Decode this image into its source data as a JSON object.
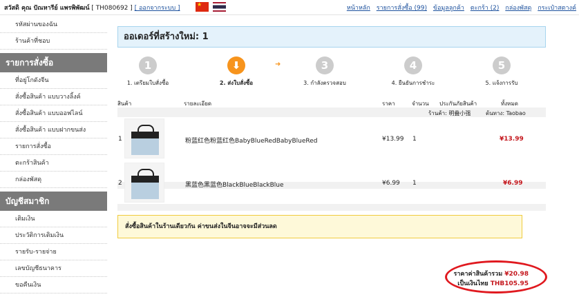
{
  "header": {
    "user_name": "สวัสดิ คุณ ปัณหารีย์ แพรพิพัฒน์",
    "user_code": "[ TH080692 ]",
    "logout": "[ ออกจากระบบ ]",
    "links": [
      "หน้าหลัก",
      "รายการสั่งซื้อ (99)",
      "ข้อมูลลูกค้า",
      "ตะกร้า (2)",
      "กล่องพัสดุ",
      "กระเป๋าสตางค์"
    ]
  },
  "sidebar": {
    "top_items": [
      "รหัสผ่านของฉัน",
      "ร้านค้าที่ชอบ"
    ],
    "section1_title": "รายการสั่งซื้อ",
    "section1_items": [
      "ที่อยู่โกดังจีน",
      "สั่งซื้อสินค้า แบบวางลิ้งค์",
      "สั่งซื้อสินค้า แบบออฟไลน์",
      "สั่งซื้อสินค้า แบบฝากขนส่ง",
      "รายการสั่งซื้อ",
      "ตะกร้าสินค้า",
      "กล่องพัสดุ"
    ],
    "section2_title": "บัญชีสมาชิก",
    "section2_items": [
      "เติมเงิน",
      "ประวัติการเติมเงิน",
      "รายรับ-รายจ่าย",
      "เลขบัญชีธนาคาร",
      "ขอคืนเงิน"
    ]
  },
  "main": {
    "title": "ออเดอร์ที่สร้างใหม่: 1",
    "steps": [
      {
        "num": "1",
        "label": "1. เตรียมใบสั่งซื้อ"
      },
      {
        "num": "",
        "label": "2. ส่งใบสั่งซื้อ"
      },
      {
        "num": "3",
        "label": "3. กำลังตรวจสอบ"
      },
      {
        "num": "4",
        "label": "4. ยืนยันการชำระ"
      },
      {
        "num": "5",
        "label": "5. แจ้งการรับ"
      }
    ],
    "table": {
      "headers": {
        "product": "สินค้า",
        "details": "รายละเอียด",
        "price": "ราคา",
        "qty": "จำนวน",
        "insurance": "ประกันภัยสินค้า",
        "total": "ทั้งหมด"
      },
      "shop_label": "ร้านค้า: 明叠小强",
      "source_label": "ต้นทาง: Taobao",
      "rows": [
        {
          "index": "1",
          "detail": "粉蓝红色粉蓝红色BabyBlueRedBabyBlueRed",
          "price": "¥13.99",
          "qty": "1",
          "total": "¥13.99"
        },
        {
          "index": "2",
          "detail": "黑蓝色黑蓝色BlackBlueBlackBlue",
          "price": "¥6.99",
          "qty": "1",
          "total": "¥6.99"
        }
      ]
    },
    "notice": "สั่งซื้อสินค้าในร้านเดียวกัน ค่าขนส่งในจีนอาจจะมีส่วนลด",
    "summary": {
      "goods_label": "ราคาค่าสินค้ารวม",
      "goods_value": "¥20.98",
      "thb_label": "เป็นเงินไทย",
      "thb_value": "THB105.95"
    }
  },
  "colors": {
    "accent": "#f7941d",
    "total_red": "#c4161c",
    "link": "#1a4f9c",
    "oval": "#e0191f"
  }
}
